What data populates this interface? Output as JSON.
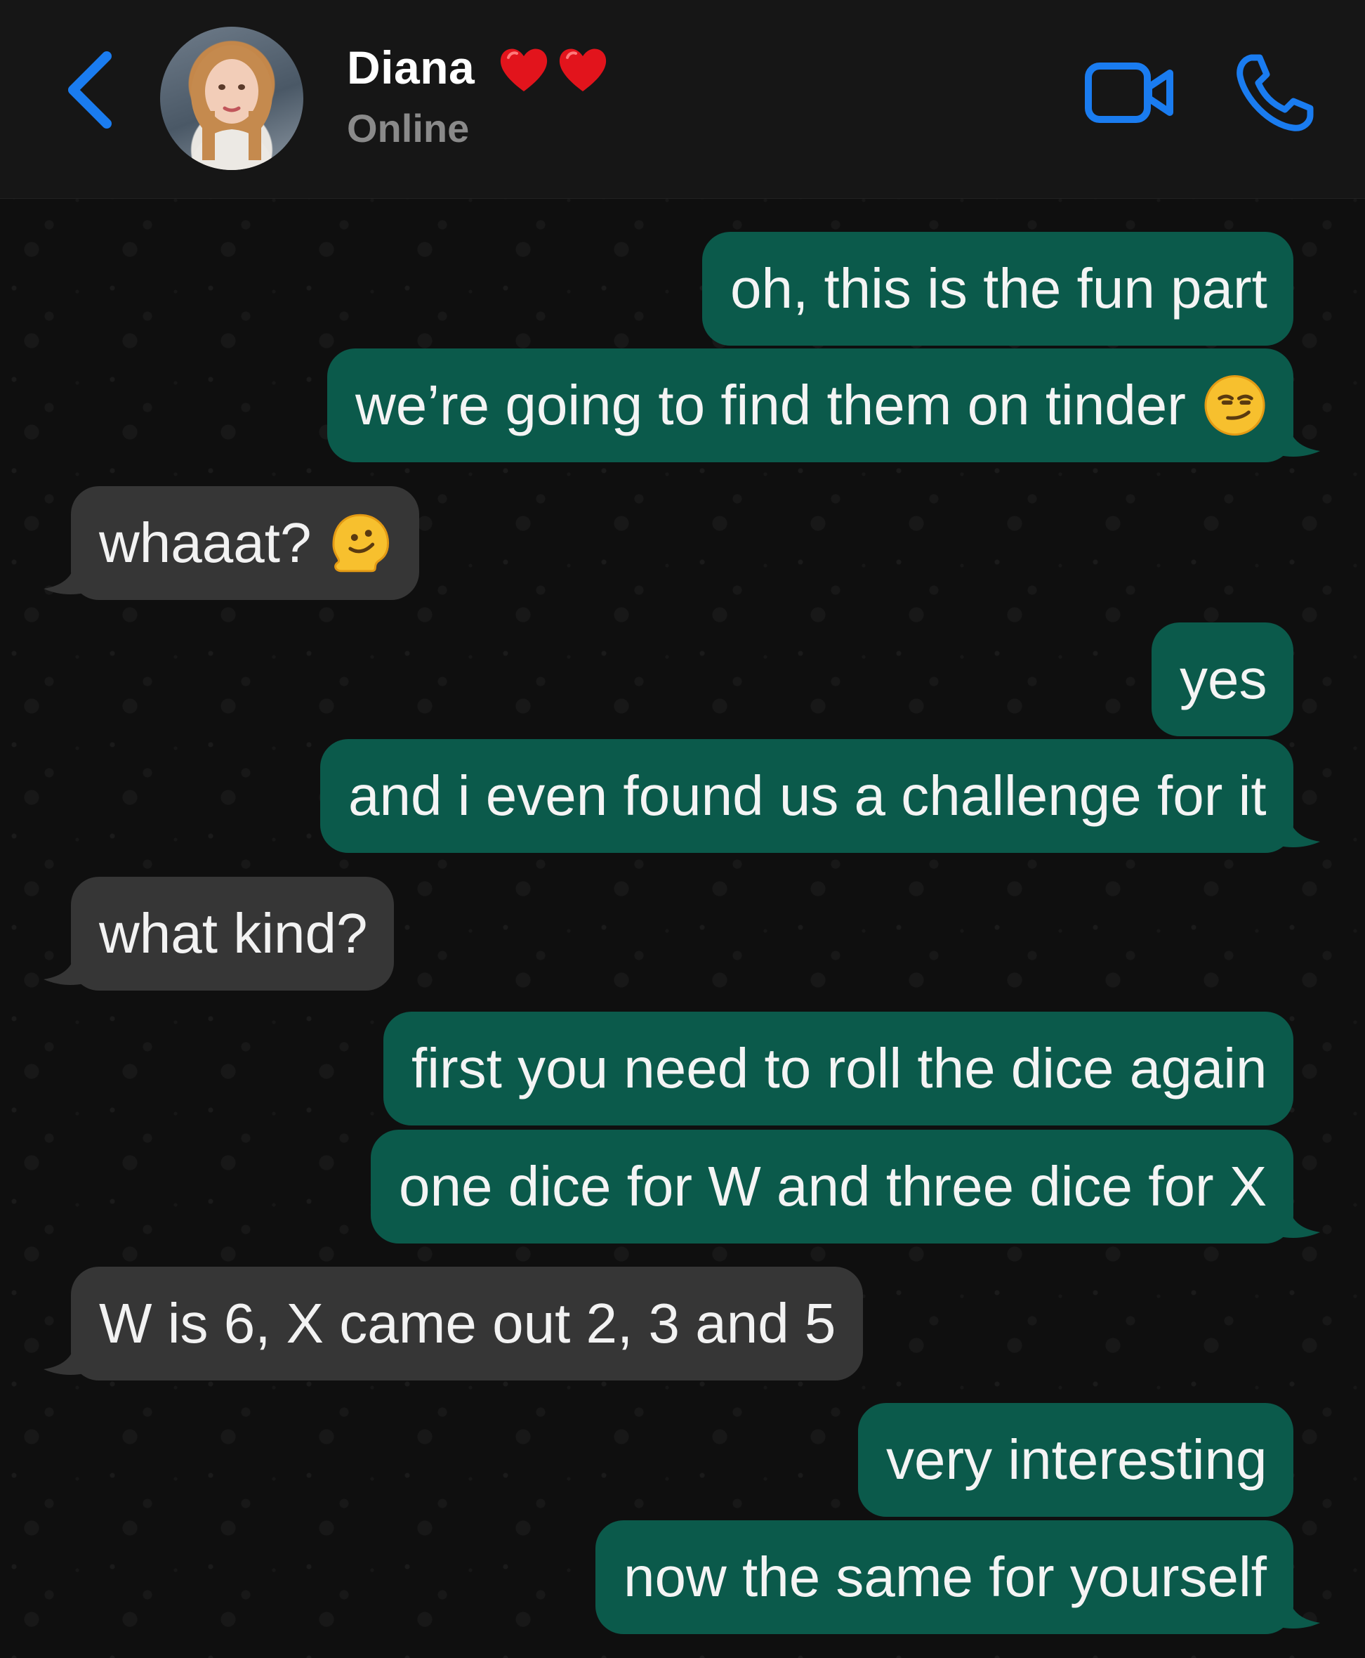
{
  "header": {
    "contact_name": "Diana",
    "status": "Online",
    "icons": [
      "back-chevron-icon",
      "heart-icon",
      "heart-icon",
      "video-call-icon",
      "phone-icon"
    ]
  },
  "colors": {
    "accent": "#1a7cf0",
    "outgoing_bubble": "#0b5a4b",
    "incoming_bubble": "#363636",
    "header_bg": "#161616",
    "heart": "#e2141c"
  },
  "messages": [
    {
      "direction": "out",
      "text": "oh, this is the fun part"
    },
    {
      "direction": "out",
      "text": "we’re going to find them on tinder",
      "emoji": "smirking-face-emoji"
    },
    {
      "direction": "in",
      "text": "whaaat?",
      "emoji": "melting-face-emoji"
    },
    {
      "direction": "out",
      "text": "yes"
    },
    {
      "direction": "out",
      "text": "and i even found us a challenge for it"
    },
    {
      "direction": "in",
      "text": "what kind?"
    },
    {
      "direction": "out",
      "text": "first you need to roll the dice again"
    },
    {
      "direction": "out",
      "text": "one dice for W and three dice for X"
    },
    {
      "direction": "in",
      "text": "W is 6, X came out 2, 3 and 5"
    },
    {
      "direction": "out",
      "text": "very interesting"
    },
    {
      "direction": "out",
      "text": "now the same for yourself"
    }
  ]
}
